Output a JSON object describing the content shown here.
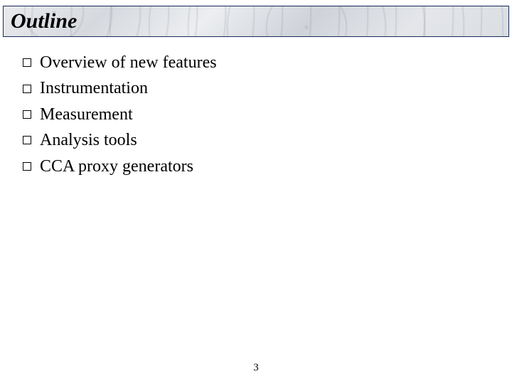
{
  "slide": {
    "title": "Outline",
    "bullets": [
      "Overview of new features",
      "Instrumentation",
      "Measurement",
      "Analysis tools",
      "CCA proxy generators"
    ],
    "page_number": "3"
  }
}
